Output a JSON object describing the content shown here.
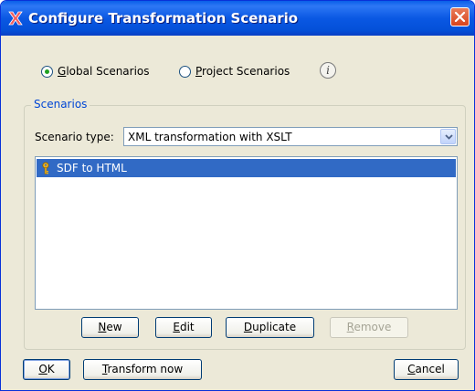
{
  "window": {
    "title": "Configure Transformation Scenario"
  },
  "scope": {
    "global": {
      "prefix": "",
      "mnemonic": "G",
      "rest": "lobal Scenarios",
      "selected": true
    },
    "project": {
      "prefix": "",
      "mnemonic": "P",
      "rest": "roject Scenarios",
      "selected": false
    },
    "info_icon_glyph": "i"
  },
  "scenarios": {
    "group_title": "Scenarios",
    "type_label": "Scenario type:",
    "type_value": "XML transformation with XSLT",
    "items": [
      {
        "label": "SDF to HTML",
        "icon": "key-icon",
        "selected": true
      }
    ]
  },
  "list_buttons": {
    "new": {
      "mnemonic": "N",
      "rest": "ew",
      "enabled": true
    },
    "edit": {
      "mnemonic": "E",
      "rest": "dit",
      "enabled": true
    },
    "duplicate": {
      "mnemonic": "D",
      "rest": "uplicate",
      "enabled": true
    },
    "remove": {
      "mnemonic": "R",
      "rest": "emove",
      "enabled": false
    }
  },
  "footer": {
    "ok": {
      "mnemonic": "O",
      "rest": "K"
    },
    "transform": {
      "mnemonic": "T",
      "rest": "ransform now"
    },
    "cancel": {
      "mnemonic": "C",
      "rest": "ancel"
    }
  },
  "colors": {
    "title_bar": "#0a58e3",
    "selection": "#316ac5",
    "group_title": "#0046d5",
    "dialog_bg": "#ece9d8"
  }
}
